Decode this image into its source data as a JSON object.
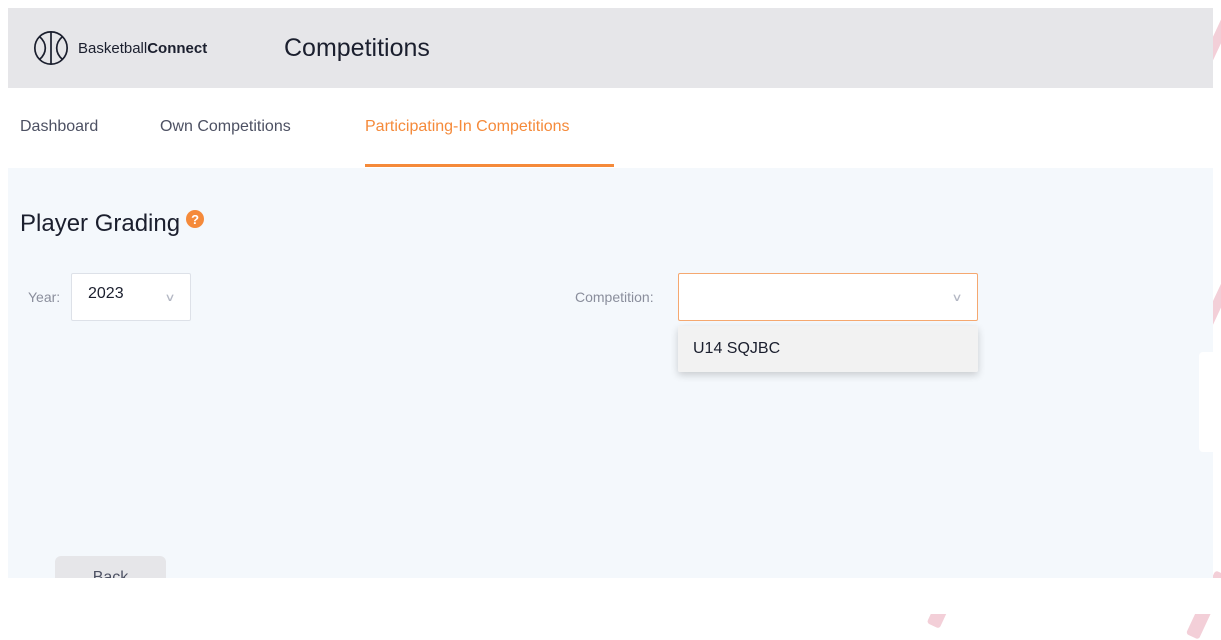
{
  "app": {
    "logo_prefix": "Basketball",
    "logo_bold": "Connect",
    "title": "Competitions"
  },
  "nav": {
    "tabs": [
      {
        "label": "Dashboard",
        "active": false
      },
      {
        "label": "Own Competitions",
        "active": false
      },
      {
        "label": "Participating-In Competitions",
        "active": true
      }
    ]
  },
  "page": {
    "heading": "Player Grading",
    "help_glyph": "?"
  },
  "filters": {
    "year_label": "Year:",
    "year_value": "2023",
    "competition_label": "Competition:",
    "competition_value": "",
    "competition_options": [
      "U14 SQJBC"
    ]
  },
  "actions": {
    "back_label": "Back"
  },
  "colors": {
    "accent": "#f58a3a",
    "header_bg": "#e6e6e9",
    "content_bg": "#f4f8fc"
  }
}
